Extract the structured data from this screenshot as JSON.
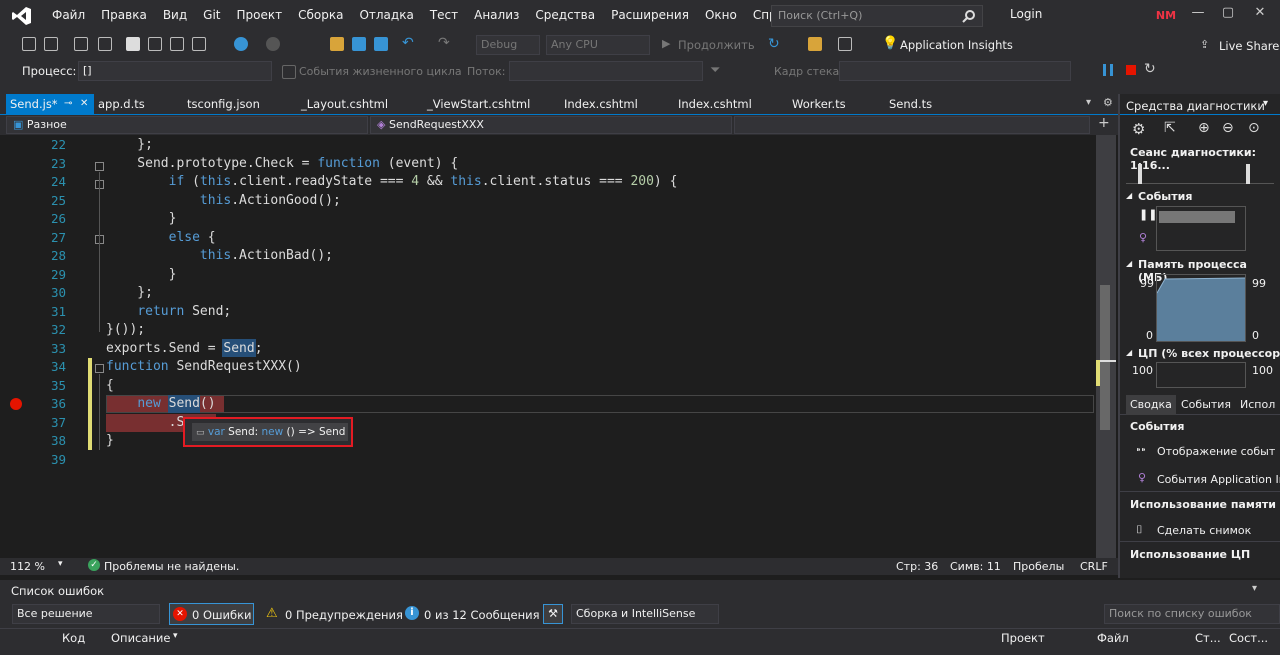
{
  "menu": {
    "items": [
      "Файл",
      "Правка",
      "Вид",
      "Git",
      "Проект",
      "Сборка",
      "Отладка",
      "Тест",
      "Анализ",
      "Средства",
      "Расширения",
      "Окно",
      "Справка"
    ],
    "search_placeholder": "Поиск (Ctrl+Q)",
    "login": "Login",
    "avatar": "NM"
  },
  "toolbar1": {
    "config": "Debug",
    "platform": "Any CPU",
    "continue": "Продолжить",
    "insights": "Application Insights",
    "live_share": "Live Share"
  },
  "toolbar2": {
    "process_label": "Процесс:",
    "process_value": "[]",
    "lifecycle": "События жизненного цикла",
    "thread_label": "Поток:",
    "stack_label": "Кадр стека:"
  },
  "tabs": [
    "Send.js*",
    "app.d.ts",
    "tsconfig.json",
    "_Layout.cshtml",
    "_ViewStart.cshtml",
    "Index.cshtml",
    "Index.cshtml",
    "Worker.ts",
    "Send.ts"
  ],
  "navbar": {
    "scope": "Разное",
    "member": "SendRequestXXX"
  },
  "code_lines": [
    {
      "n": "22",
      "text": "    };"
    },
    {
      "n": "23",
      "text": "    Send.prototype.Check = function (event) {"
    },
    {
      "n": "24",
      "text": "        if (this.client.readyState === 4 && this.client.status === 200) {"
    },
    {
      "n": "25",
      "text": "            this.ActionGood();"
    },
    {
      "n": "26",
      "text": "        }"
    },
    {
      "n": "27",
      "text": "        else {"
    },
    {
      "n": "28",
      "text": "            this.ActionBad();"
    },
    {
      "n": "29",
      "text": "        }"
    },
    {
      "n": "30",
      "text": "    };"
    },
    {
      "n": "31",
      "text": "    return Send;"
    },
    {
      "n": "32",
      "text": "}());"
    },
    {
      "n": "33",
      "text": "exports.Send = Send;"
    },
    {
      "n": "34",
      "text": "function SendRequestXXX()"
    },
    {
      "n": "35",
      "text": "{"
    },
    {
      "n": "36",
      "text": "    new Send()"
    },
    {
      "n": "37",
      "text": "        .S"
    },
    {
      "n": "38",
      "text": "}"
    },
    {
      "n": "39",
      "text": ""
    }
  ],
  "tooltip": {
    "kw": "var",
    "name": "Send:",
    "kw2": "new",
    "sig": "() => Send"
  },
  "zoombar": {
    "zoom": "112 %",
    "problems": "Проблемы не найдены.",
    "line": "Стр: 36",
    "col": "Симв: 11",
    "spaces": "Пробелы",
    "eol": "CRLF"
  },
  "errors": {
    "title": "Список ошибок",
    "scope": "Все решение",
    "errors": "0 Ошибки",
    "warnings": "0 Предупреждения",
    "messages": "0 из 12 Сообщения",
    "build": "Сборка и IntelliSense",
    "search_placeholder": "Поиск по списку ошибок",
    "columns": [
      "Код",
      "Описание",
      "Проект",
      "Файл",
      "Ст...",
      "Сост..."
    ]
  },
  "diag": {
    "title": "Средства диагностики",
    "session": "Сеанс диагностики: 1:16...",
    "events": "События",
    "memory": "Память процесса (МБ)",
    "mem_max": "99",
    "mem_min": "0",
    "cpu": "ЦП (% всех процессоров)",
    "cpu_max": "100",
    "tabs": [
      "Сводка",
      "События",
      "Испол"
    ],
    "events_section": "События",
    "show_events": "Отображение событ",
    "ai_events": "События Application In",
    "mem_usage": "Использование памяти",
    "snapshot": "Сделать снимок",
    "cpu_usage": "Использование ЦП"
  }
}
